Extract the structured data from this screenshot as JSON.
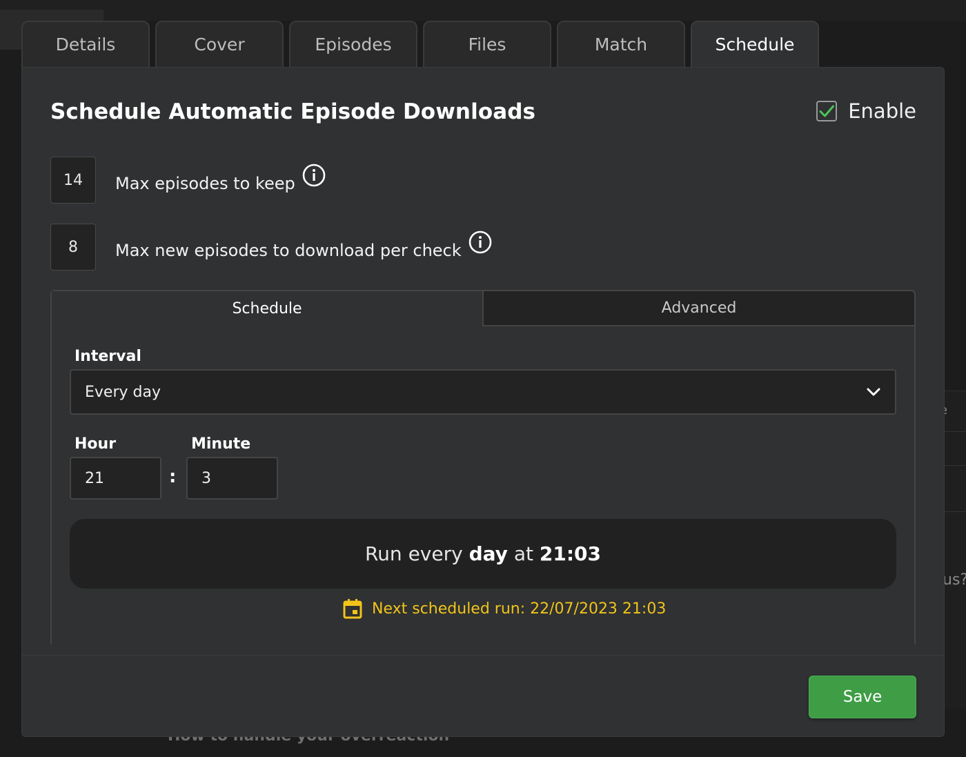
{
  "background": {
    "right_fragments": [
      "e",
      "us?"
    ],
    "bottom_fragment": "How to handle your overreaction"
  },
  "tabs": [
    {
      "label": "Details",
      "active": false
    },
    {
      "label": "Cover",
      "active": false
    },
    {
      "label": "Episodes",
      "active": false
    },
    {
      "label": "Files",
      "active": false
    },
    {
      "label": "Match",
      "active": false
    },
    {
      "label": "Schedule",
      "active": true
    }
  ],
  "modal": {
    "title": "Schedule Automatic Episode Downloads",
    "enable": {
      "label": "Enable",
      "checked": true
    },
    "max_keep": {
      "value": "14",
      "label": "Max episodes to keep",
      "icon": "info-icon"
    },
    "max_new": {
      "value": "8",
      "label": "Max new episodes to download per check",
      "icon": "info-icon"
    },
    "inner_tabs": {
      "schedule": "Schedule",
      "advanced": "Advanced",
      "active": "Schedule"
    },
    "interval": {
      "label": "Interval",
      "value": "Every day"
    },
    "hour": {
      "label": "Hour",
      "value": "21"
    },
    "minute": {
      "label": "Minute",
      "value": "3"
    },
    "time_separator": ":",
    "summary": {
      "prefix": "Run every ",
      "unit": "day",
      "middle": " at ",
      "time": "21:03"
    },
    "next_run": "Next scheduled run: 22/07/2023 21:03",
    "save_label": "Save"
  },
  "colors": {
    "accent_green": "#3e9d45",
    "next_run_yellow": "#f2c41a",
    "check_green": "#4cc45a",
    "panel_bg": "#2f3132"
  }
}
